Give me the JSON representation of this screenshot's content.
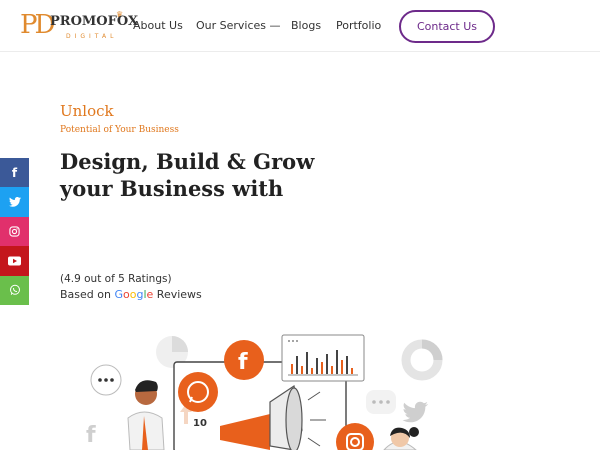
{
  "brand": {
    "mark_p": "P",
    "mark_d": "D",
    "name": "PROMOFOX",
    "sub": "DIGITAL"
  },
  "nav": {
    "items": [
      "About Us",
      "Our Services —",
      "Blogs",
      "Portfolio"
    ],
    "contact_label": "Contact Us"
  },
  "social": {
    "icons": [
      "facebook-icon",
      "twitter-icon",
      "instagram-icon",
      "youtube-icon",
      "whatsapp-icon"
    ],
    "glyphs": [
      "f",
      "t",
      "◎",
      "▶",
      "✆"
    ]
  },
  "hero": {
    "eyebrow": "Unlock",
    "eyebrow_sub": "Potential of Your Business",
    "headline_line1": "Design, Build & Grow",
    "headline_line2": "your Business with",
    "rating_text": "(4.9 out of 5 Ratings)",
    "based_on": "Based on",
    "google": [
      "G",
      "o",
      "o",
      "g",
      "l",
      "e"
    ],
    "reviews": "Reviews"
  },
  "illustration": {
    "badge": "10"
  },
  "colors": {
    "accent_orange": "#e0781e",
    "contact_purple": "#6d2a8a",
    "facebook": "#3b5998",
    "twitter": "#1da1f2",
    "instagram": "#e1306c",
    "youtube": "#c4161c",
    "whatsapp": "#6abf4b"
  }
}
